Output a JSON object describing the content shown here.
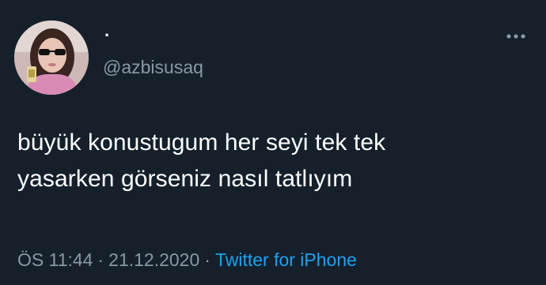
{
  "user": {
    "display_name": "·",
    "handle": "@azbisusaq"
  },
  "tweet": {
    "line1": "büyük konustugum her seyi tek tek",
    "line2": "yasarken görseniz nasıl tatlıyım"
  },
  "meta": {
    "time": "ÖS 11:44",
    "separator": "·",
    "date": "21.12.2020",
    "source": "Twitter for iPhone"
  },
  "icons": {
    "more": "more-horizontal-icon",
    "avatar": "profile-photo"
  },
  "colors": {
    "background": "#15202b",
    "text": "#ffffff",
    "secondary": "#8899a6",
    "accent": "#1da1f2"
  }
}
